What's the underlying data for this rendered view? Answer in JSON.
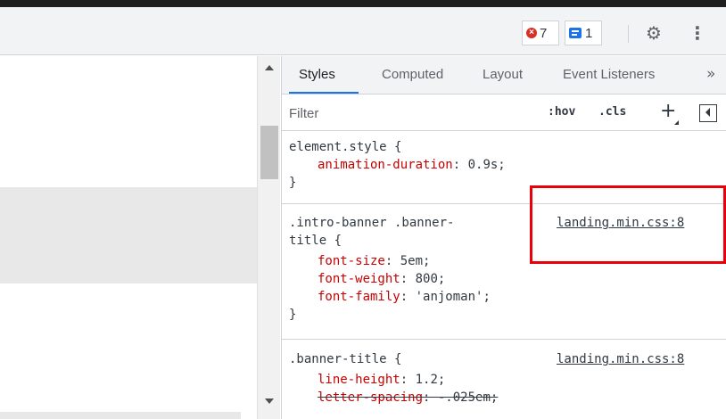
{
  "toolbar": {
    "errors_count": "7",
    "issues_count": "1",
    "settings_icon": "gear-icon",
    "menu_icon": "kebab-menu-icon",
    "error_icon_glyph": "×",
    "gear_glyph": "⚙",
    "kebab_glyph": "⋮"
  },
  "tabs": {
    "items": [
      "Styles",
      "Computed",
      "Layout",
      "Event Listeners"
    ],
    "active": "Styles",
    "more_glyph": "»"
  },
  "filter": {
    "placeholder": "Filter",
    "hov_label": ":hov",
    "cls_label": ".cls",
    "plus_label": "+"
  },
  "rules": {
    "element_style": {
      "selector": "element.style {",
      "prop": "animation-duration",
      "value": " 0.9s;",
      "close": "}"
    },
    "intro_banner": {
      "selector_line1": ".intro-banner .banner-",
      "selector_line2": "title {",
      "source": "landing.min.css:8",
      "decls": [
        {
          "prop": "font-size",
          "value": " 5em;"
        },
        {
          "prop": "font-weight",
          "value": " 800;"
        },
        {
          "prop": "font-family",
          "value": " 'anjoman';"
        }
      ],
      "close": "}"
    },
    "banner_title": {
      "selector": ".banner-title {",
      "source": "landing.min.css:8",
      "decls": [
        {
          "prop": "line-height",
          "value": " 1.2;"
        },
        {
          "prop": "letter-spacing",
          "value": " -.025em;"
        }
      ]
    }
  },
  "colors": {
    "highlight_box": "#e8000b",
    "property": "#c80000",
    "active_tab": "#1a73e8"
  }
}
